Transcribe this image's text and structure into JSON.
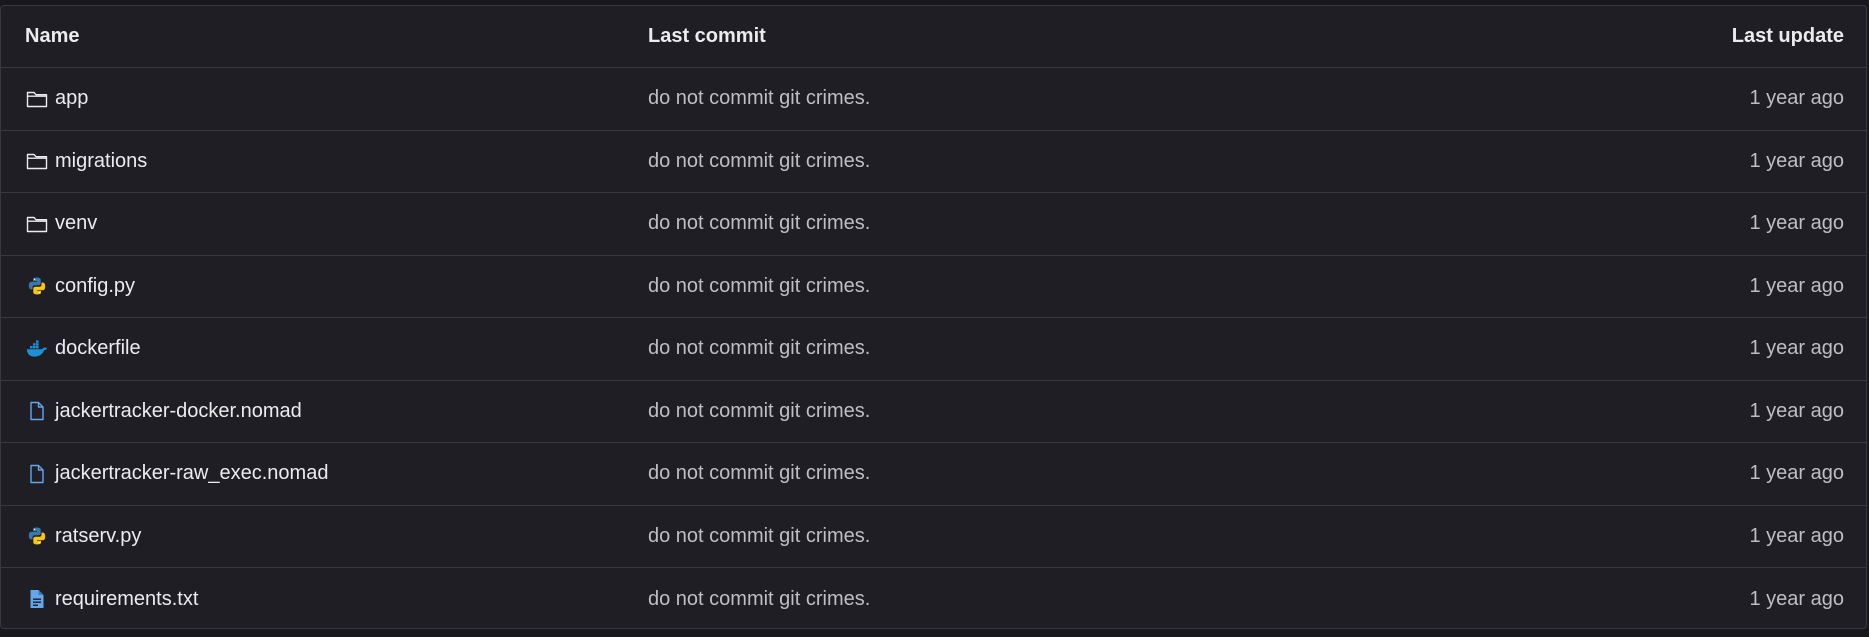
{
  "header": {
    "name": "Name",
    "last_commit": "Last commit",
    "last_update": "Last update"
  },
  "rows": [
    {
      "name": "app",
      "icon": "folder-icon",
      "commit": "do not commit git crimes.",
      "updated": "1 year ago"
    },
    {
      "name": "migrations",
      "icon": "folder-icon",
      "commit": "do not commit git crimes.",
      "updated": "1 year ago"
    },
    {
      "name": "venv",
      "icon": "folder-icon",
      "commit": "do not commit git crimes.",
      "updated": "1 year ago"
    },
    {
      "name": "config.py",
      "icon": "python-icon",
      "commit": "do not commit git crimes.",
      "updated": "1 year ago"
    },
    {
      "name": "dockerfile",
      "icon": "docker-icon",
      "commit": "do not commit git crimes.",
      "updated": "1 year ago"
    },
    {
      "name": "jackertracker-docker.nomad",
      "icon": "file-icon",
      "commit": "do not commit git crimes.",
      "updated": "1 year ago"
    },
    {
      "name": "jackertracker-raw_exec.nomad",
      "icon": "file-icon",
      "commit": "do not commit git crimes.",
      "updated": "1 year ago"
    },
    {
      "name": "ratserv.py",
      "icon": "python-icon",
      "commit": "do not commit git crimes.",
      "updated": "1 year ago"
    },
    {
      "name": "requirements.txt",
      "icon": "text-file-icon",
      "commit": "do not commit git crimes.",
      "updated": "1 year ago"
    }
  ],
  "colors": {
    "background": "#1f1e24",
    "border": "#3a383f",
    "text": "#ececef",
    "muted_text": "#bfbfc3",
    "file_icon": "#63a6e9",
    "docker_icon": "#1d91d6",
    "python_blue": "#3b77a8",
    "python_yellow": "#f5c518"
  }
}
